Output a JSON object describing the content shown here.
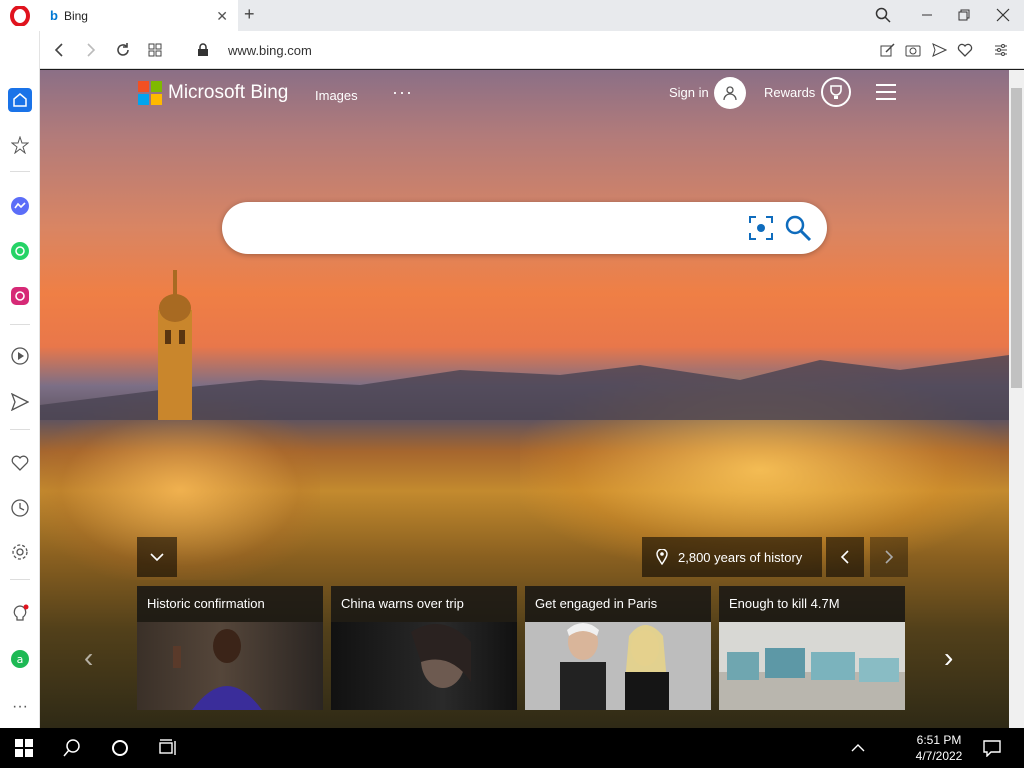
{
  "browser": {
    "tab_title": "Bing",
    "url": "www.bing.com"
  },
  "sidebar": {
    "items": [
      "home-icon",
      "star-icon",
      "messenger-icon",
      "whatsapp-icon",
      "instagram-icon",
      "player-icon",
      "send-icon",
      "heart-icon",
      "history-icon",
      "settings-icon",
      "tips-icon",
      "aria-icon",
      "more-icon"
    ]
  },
  "bing": {
    "logo_text": "Microsoft Bing",
    "nav_images": "Images",
    "more": "···",
    "sign_in": "Sign in",
    "rewards": "Rewards",
    "search_placeholder": ""
  },
  "image_info": {
    "caption": "2,800 years of history"
  },
  "news_cards": [
    {
      "title": "Historic confirmation"
    },
    {
      "title": "China warns over trip"
    },
    {
      "title": "Get engaged in Paris"
    },
    {
      "title": "Enough to kill 4.7M"
    }
  ],
  "taskbar": {
    "time": "6:51 PM",
    "date": "4/7/2022"
  },
  "colors": {
    "opera_red": "#e0131e",
    "bing_blue": "#0078d4",
    "accent_teal": "#0f6cbd"
  }
}
